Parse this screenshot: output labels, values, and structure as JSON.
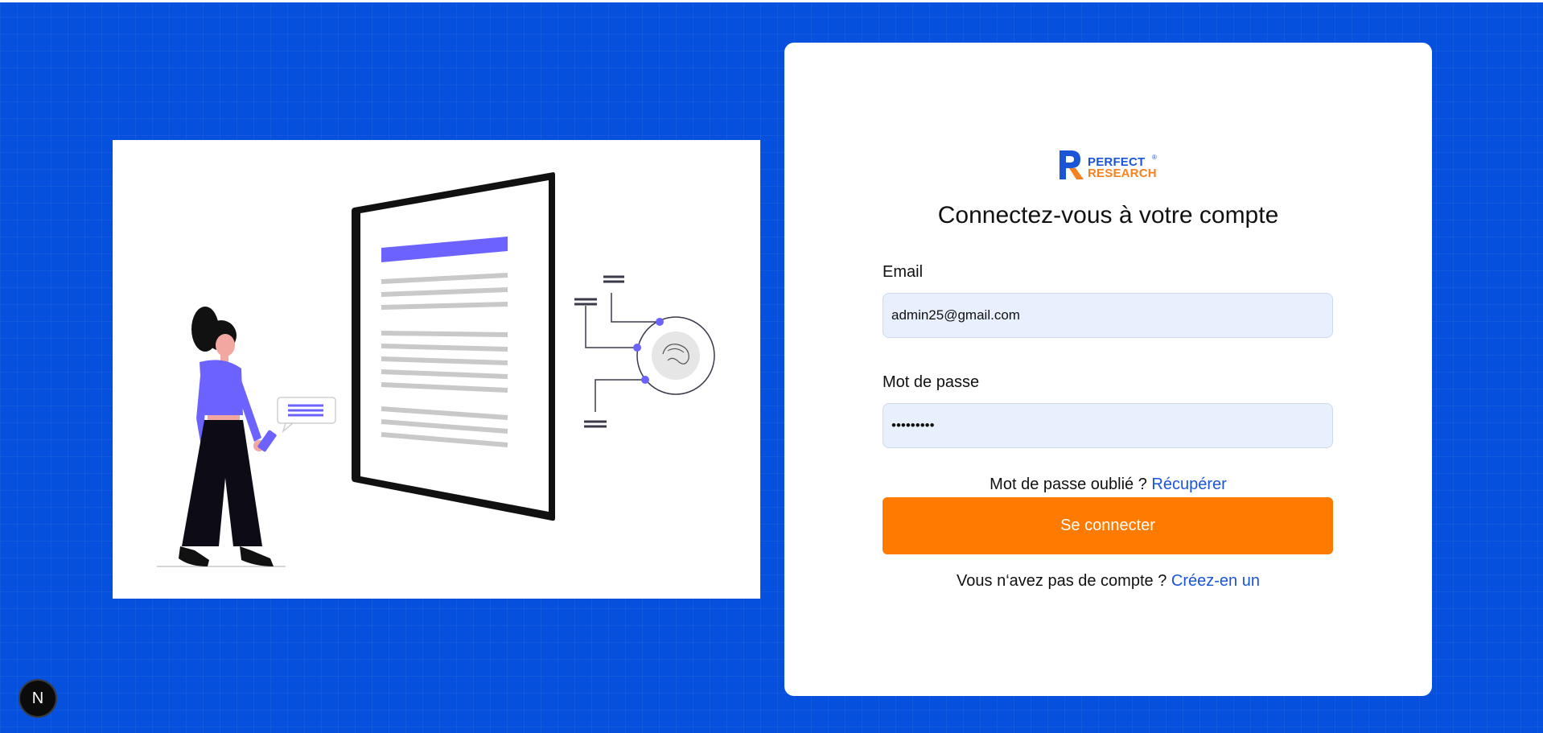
{
  "brand": {
    "logo_line1": "PERFECT",
    "logo_line2": "RESEARCH",
    "logo_reg": "®",
    "colors": {
      "primary": "#1a55d8",
      "accent": "#f58220",
      "background": "#0550dc",
      "button": "#ff7b00"
    }
  },
  "login": {
    "title": "Connectez-vous à votre compte",
    "email_label": "Email",
    "email_value": "admin25@gmail.com",
    "password_label": "Mot de passe",
    "password_value": "•••••••••",
    "forgot_text": "Mot de passe oublié ?",
    "forgot_link": "Récupérer",
    "submit_label": "Se connecter",
    "signup_text": "Vous n‘avez pas de compte ?",
    "signup_link": "Créez-en un"
  },
  "illustration": {
    "icon": "woman-reading-document-fingerprint-illustration"
  },
  "dev_badge": {
    "label": "N",
    "icon": "nextjs-icon"
  }
}
